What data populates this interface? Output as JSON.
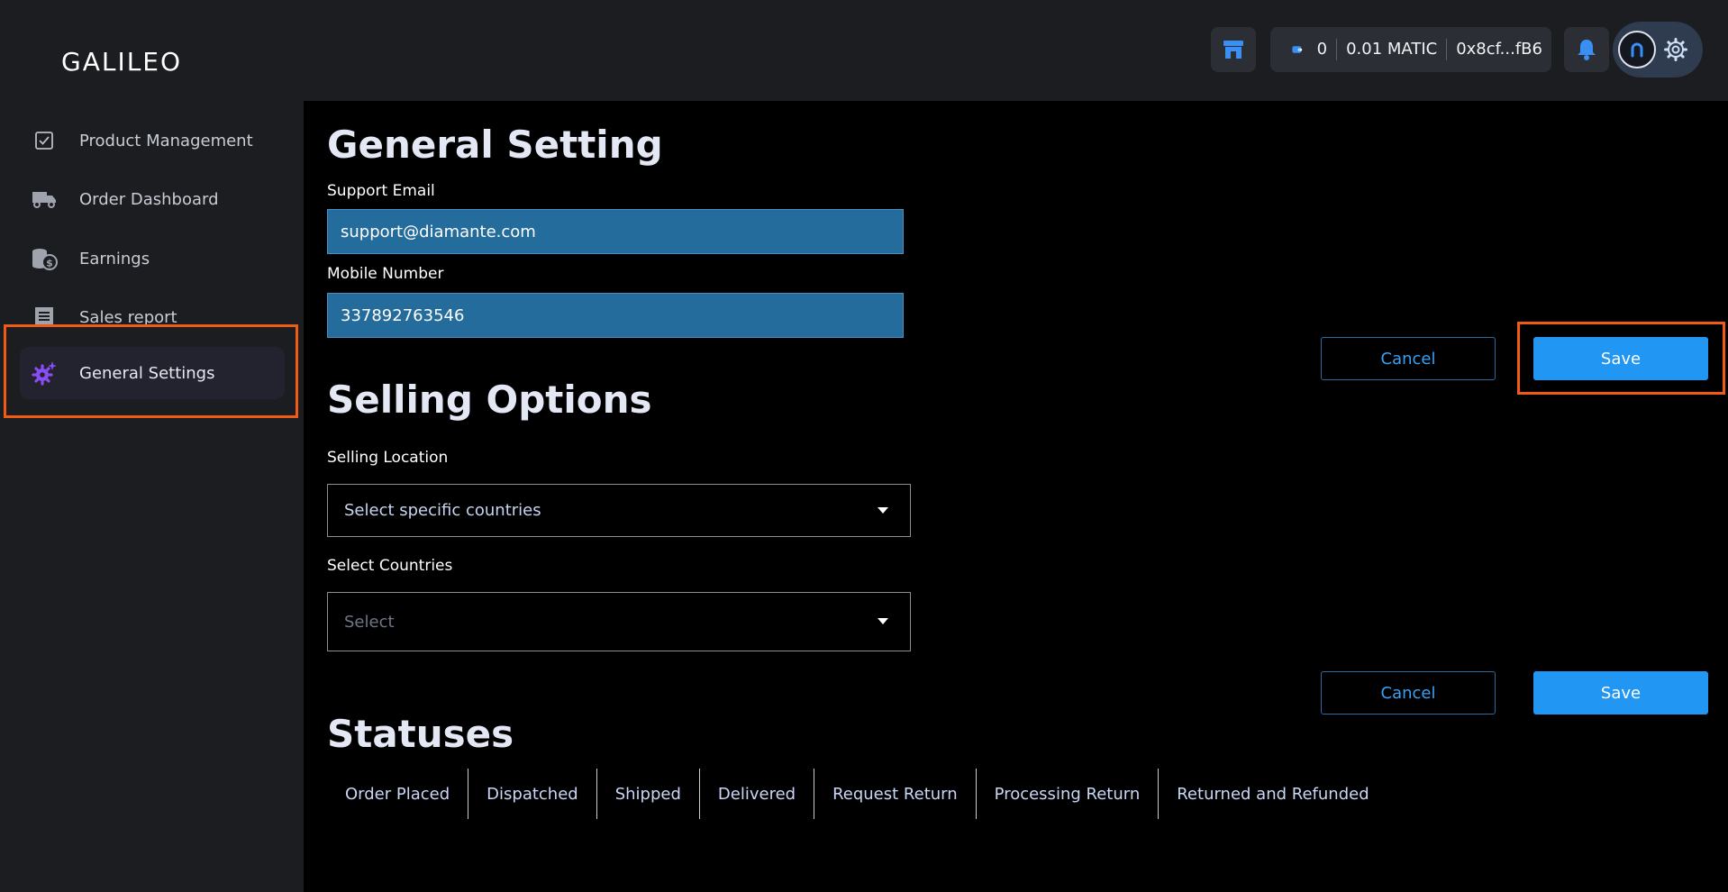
{
  "header": {
    "brand": "GALILEO",
    "wallet": {
      "count": "0",
      "balance": "0.01 MATIC",
      "address": "0x8cf...fB6"
    }
  },
  "sidebar": {
    "items": [
      {
        "label": "Product Management",
        "icon": "checkbox-icon"
      },
      {
        "label": "Order Dashboard",
        "icon": "truck-icon"
      },
      {
        "label": "Earnings",
        "icon": "coins-icon"
      },
      {
        "label": "Sales report",
        "icon": "receipt-icon"
      },
      {
        "label": "General Settings",
        "icon": "gear-sparkle-icon",
        "active": true
      }
    ]
  },
  "general": {
    "title": "General Setting",
    "support_email_label": "Support Email",
    "support_email_value": "support@diamante.com",
    "mobile_label": "Mobile Number",
    "mobile_value": "337892763546",
    "cancel_label": "Cancel",
    "save_label": "Save"
  },
  "selling": {
    "title": "Selling Options",
    "location_label": "Selling Location",
    "location_value": "Select specific countries",
    "countries_label": "Select Countries",
    "countries_placeholder": "Select",
    "cancel_label": "Cancel",
    "save_label": "Save"
  },
  "statuses": {
    "title": "Statuses",
    "tabs": [
      "Order Placed",
      "Dispatched",
      "Shipped",
      "Delivered",
      "Request Return",
      "Processing Return",
      "Returned and Refunded"
    ]
  },
  "colors": {
    "accent": "#2196f3",
    "highlight": "#f05a14",
    "sidebar_bg": "#1b1d21",
    "input_bg": "#246c9c"
  }
}
